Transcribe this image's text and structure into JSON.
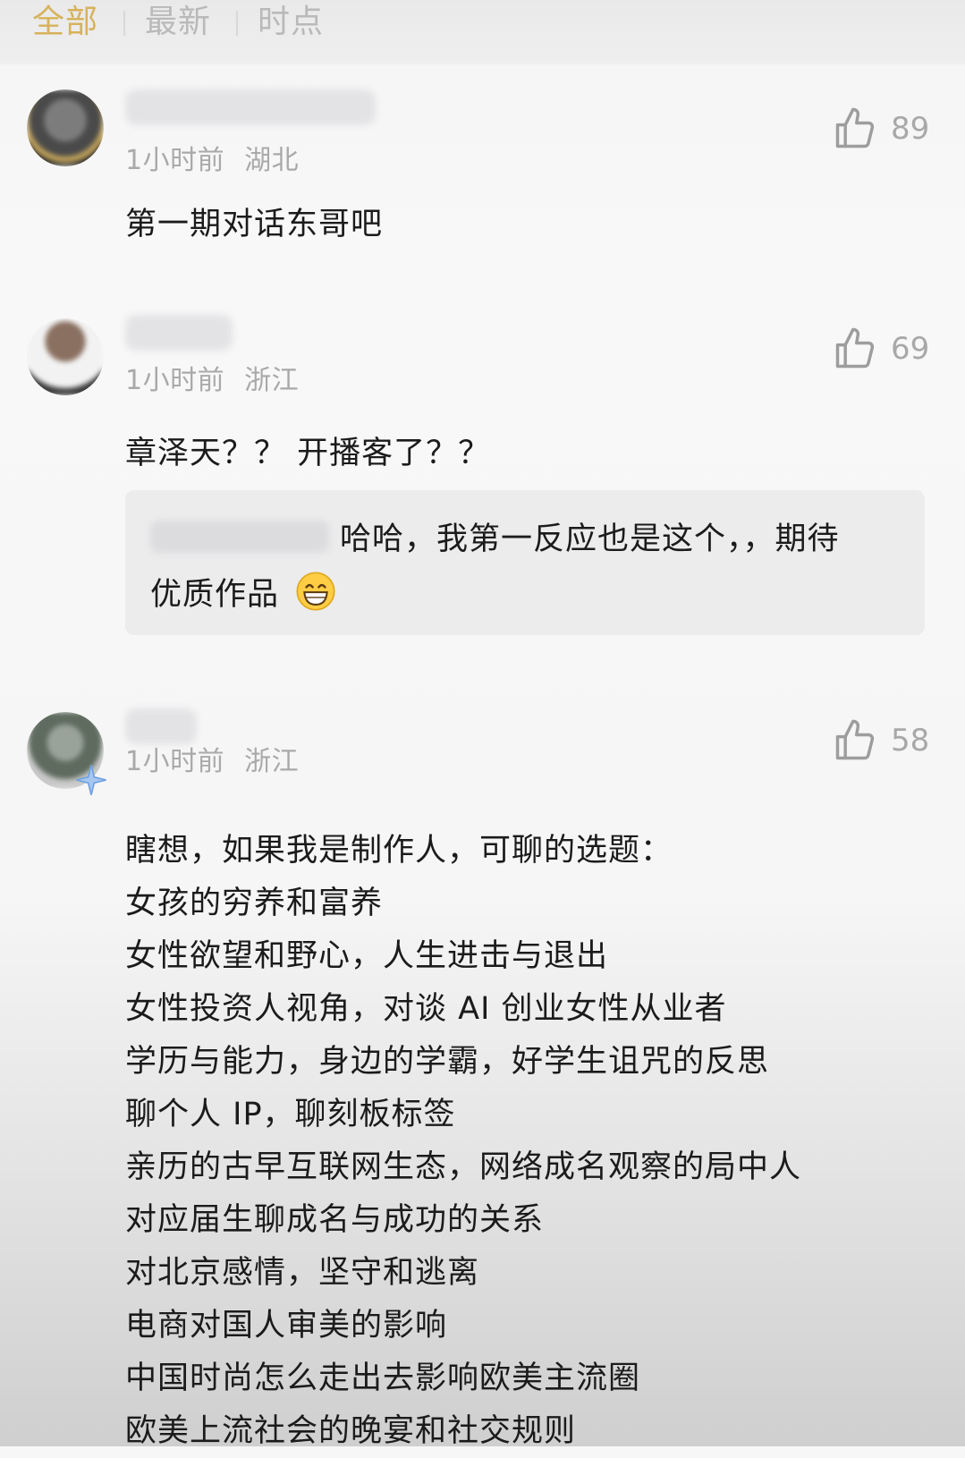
{
  "tabs": [
    {
      "label": "全部",
      "active": true
    },
    {
      "label": "最新",
      "active": false
    },
    {
      "label": "时点",
      "active": false
    }
  ],
  "comments": [
    {
      "time": "1小时前",
      "location": "湖北",
      "likes": "89",
      "text": "第一期对话东哥吧"
    },
    {
      "time": "1小时前",
      "location": "浙江",
      "likes": "69",
      "text": "章泽天？？ 开播客了？？",
      "reply": {
        "line1": "哈哈，我第一反应也是这个，，期待",
        "line2": "优质作品",
        "emoji": "grin-emoji"
      }
    },
    {
      "time": "1小时前",
      "location": "浙江",
      "likes": "58",
      "lines": [
        "瞎想，如果我是制作人，可聊的选题：",
        "女孩的穷养和富养",
        "女性欲望和野心，人生进击与退出",
        "女性投资人视角，对谈 AI 创业女性从业者",
        "学历与能力，身边的学霸，好学生诅咒的反思",
        "聊个人 IP，聊刻板标签",
        "亲历的古早互联网生态，网络成名观察的局中人",
        "对应届生聊成名与成功的关系",
        "对北京感情，坚守和逃离",
        "电商对国人审美的影响",
        "中国时尚怎么走出去影响欧美主流圈",
        "欧美上流社会的晚宴和社交规则"
      ]
    }
  ],
  "colors": {
    "active_tab": "#d6b25c",
    "inactive_tab": "#b9b9b9",
    "meta": "#a9a9a9"
  },
  "icons": {
    "like": "thumbs-up-icon"
  }
}
